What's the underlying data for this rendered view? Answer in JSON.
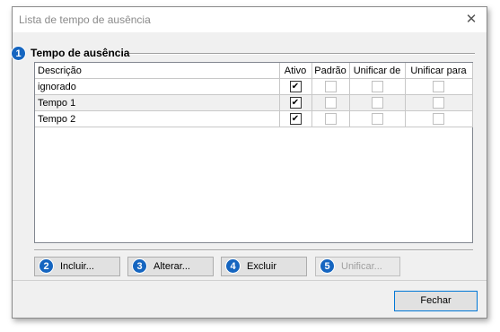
{
  "window": {
    "title": "Lista de tempo de ausência"
  },
  "group": {
    "badge": "1",
    "title": "Tempo de ausência"
  },
  "grid": {
    "columns": [
      "Descrição",
      "Ativo",
      "Padrão",
      "Unificar de",
      "Unificar para"
    ],
    "rows": [
      {
        "descricao": "ignorado",
        "ativo": true,
        "padrao": false,
        "unificar_de": false,
        "unificar_para": false
      },
      {
        "descricao": "Tempo 1",
        "ativo": true,
        "padrao": false,
        "unificar_de": false,
        "unificar_para": false
      },
      {
        "descricao": "Tempo 2",
        "ativo": true,
        "padrao": false,
        "unificar_de": false,
        "unificar_para": false
      }
    ]
  },
  "buttons": {
    "incluir": {
      "badge": "2",
      "label": "Incluir..."
    },
    "alterar": {
      "badge": "3",
      "label": "Alterar..."
    },
    "excluir": {
      "badge": "4",
      "label": "Excluir"
    },
    "unificar": {
      "badge": "5",
      "label": "Unificar..."
    },
    "fechar": {
      "label": "Fechar"
    }
  },
  "colors": {
    "badge": "#1565c0",
    "accent_border": "#0078d7"
  },
  "icons": {
    "close": "close-icon",
    "check": "check-icon"
  }
}
